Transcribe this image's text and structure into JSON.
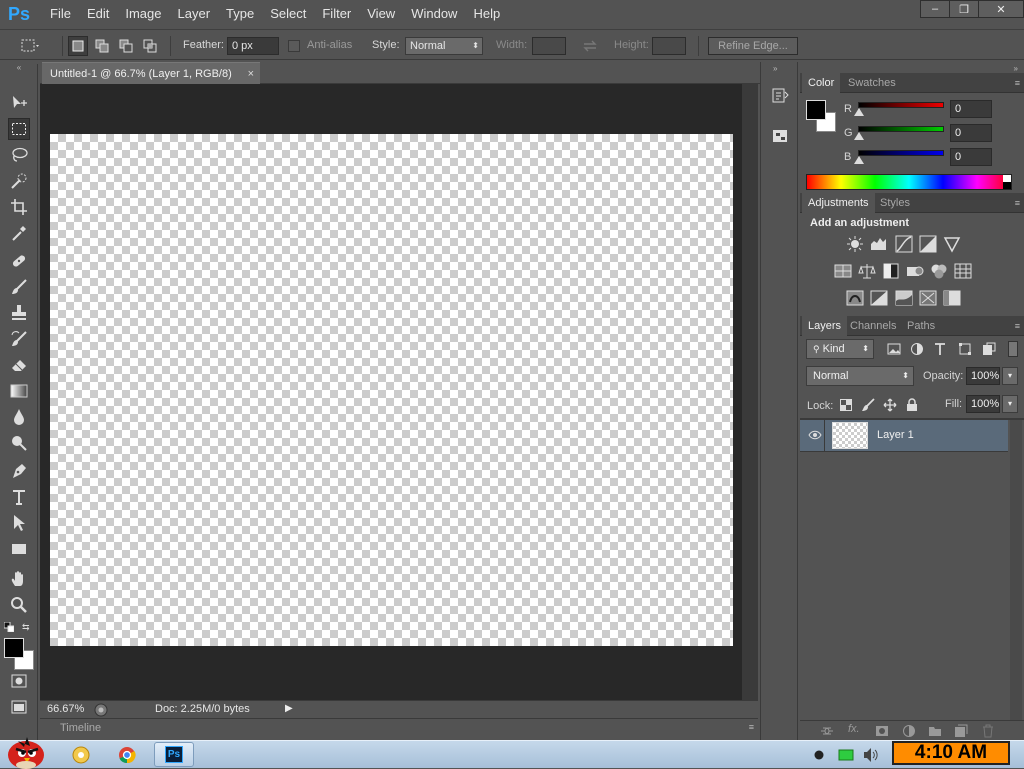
{
  "app": {
    "logo": "Ps"
  },
  "menu": [
    "File",
    "Edit",
    "Image",
    "Layer",
    "Type",
    "Select",
    "Filter",
    "View",
    "Window",
    "Help"
  ],
  "window_controls": {
    "minimize": "–",
    "restore": "❐",
    "close": "✕"
  },
  "options": {
    "feather_label": "Feather:",
    "feather_value": "0 px",
    "antialias_label": "Anti-alias",
    "style_label": "Style:",
    "style_value": "Normal",
    "width_label": "Width:",
    "height_label": "Height:",
    "refine_edge": "Refine Edge..."
  },
  "document": {
    "tab_title": "Untitled-1 @ 66.7% (Layer 1, RGB/8)",
    "tab_close": "×",
    "zoom": "66.67%",
    "doc_info": "Doc: 2.25M/0 bytes"
  },
  "timeline": {
    "label": "Timeline"
  },
  "color_panel": {
    "tabs": [
      "Color",
      "Swatches"
    ],
    "r_label": "R",
    "g_label": "G",
    "b_label": "B",
    "r": "0",
    "g": "0",
    "b": "0",
    "colors": {
      "foreground": "#000000",
      "background": "#ffffff",
      "r_slider": "#e00000",
      "g_slider": "#00c800",
      "b_slider": "#0000e0"
    }
  },
  "adjustments_panel": {
    "tabs": [
      "Adjustments",
      "Styles"
    ],
    "heading": "Add an adjustment"
  },
  "layers_panel": {
    "tabs": [
      "Layers",
      "Channels",
      "Paths"
    ],
    "filter_kind": "Kind",
    "blend_mode": "Normal",
    "opacity_label": "Opacity:",
    "opacity_value": "100%",
    "lock_label": "Lock:",
    "fill_label": "Fill:",
    "fill_value": "100%",
    "layers": [
      {
        "name": "Layer 1"
      }
    ]
  },
  "taskbar": {
    "clock": "4:10 AM",
    "ps_label": "Ps"
  }
}
